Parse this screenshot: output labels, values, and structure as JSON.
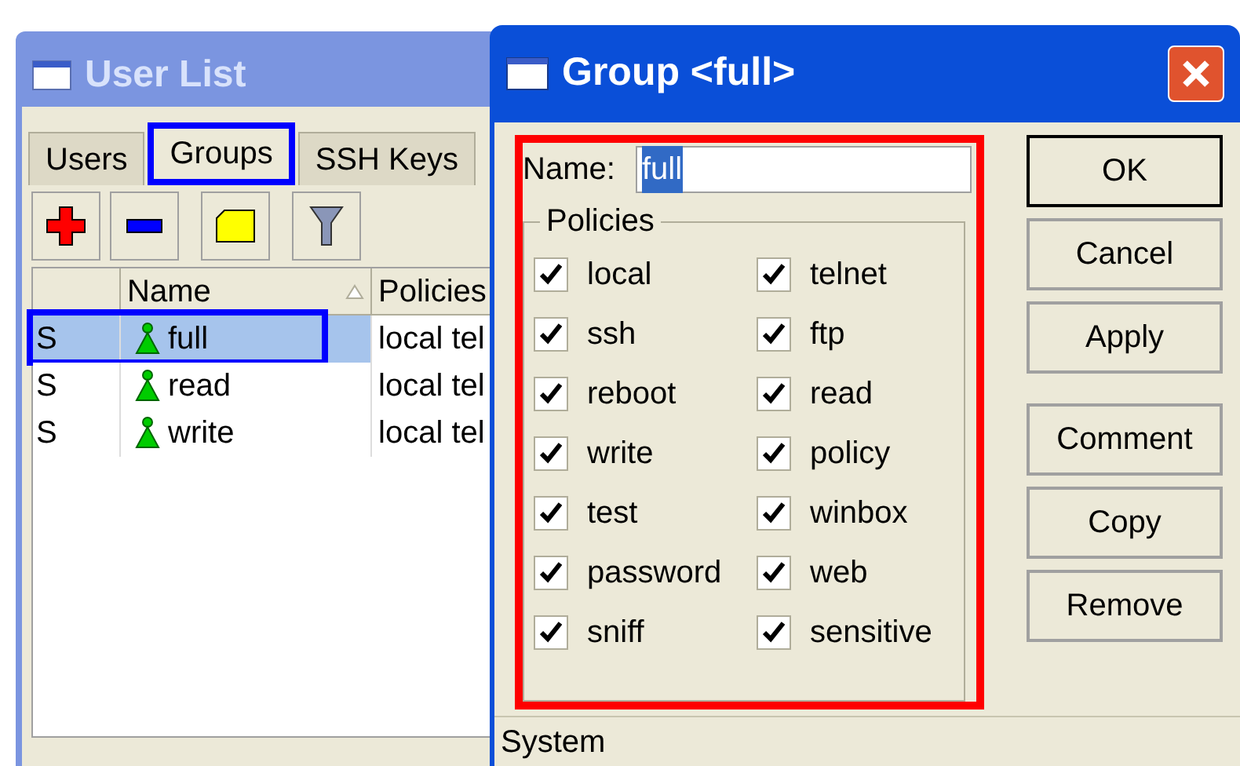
{
  "user_list": {
    "title": "User List",
    "tabs": [
      {
        "label": "Users",
        "selected": false
      },
      {
        "label": "Groups",
        "selected": true
      },
      {
        "label": "SSH Keys",
        "selected": false
      }
    ],
    "table": {
      "columns": [
        {
          "label": "Name",
          "sorted": true
        },
        {
          "label": "Policies",
          "sorted": false
        }
      ],
      "rows": [
        {
          "flag": "S",
          "name": "full",
          "policies": "local tel",
          "selected": true
        },
        {
          "flag": "S",
          "name": "read",
          "policies": "local tel",
          "selected": false
        },
        {
          "flag": "S",
          "name": "write",
          "policies": "local tel",
          "selected": false
        }
      ]
    }
  },
  "group_dialog": {
    "title": "Group <full>",
    "name_label": "Name:",
    "name_value": "full",
    "name_value_selected": true,
    "policies_label": "Policies",
    "policies": [
      {
        "label": "local",
        "checked": true
      },
      {
        "label": "telnet",
        "checked": true
      },
      {
        "label": "ssh",
        "checked": true
      },
      {
        "label": "ftp",
        "checked": true
      },
      {
        "label": "reboot",
        "checked": true
      },
      {
        "label": "read",
        "checked": true
      },
      {
        "label": "write",
        "checked": true
      },
      {
        "label": "policy",
        "checked": true
      },
      {
        "label": "test",
        "checked": true
      },
      {
        "label": "winbox",
        "checked": true
      },
      {
        "label": "password",
        "checked": true
      },
      {
        "label": "web",
        "checked": true
      },
      {
        "label": "sniff",
        "checked": true
      },
      {
        "label": "sensitive",
        "checked": true
      }
    ],
    "buttons": [
      {
        "label": "OK",
        "kind": "default"
      },
      {
        "label": "Cancel",
        "kind": "normal"
      },
      {
        "label": "Apply",
        "kind": "normal"
      },
      {
        "label": "Comment",
        "kind": "spaced"
      },
      {
        "label": "Copy",
        "kind": "normal"
      },
      {
        "label": "Remove",
        "kind": "normal"
      }
    ],
    "status_bar": "System"
  }
}
